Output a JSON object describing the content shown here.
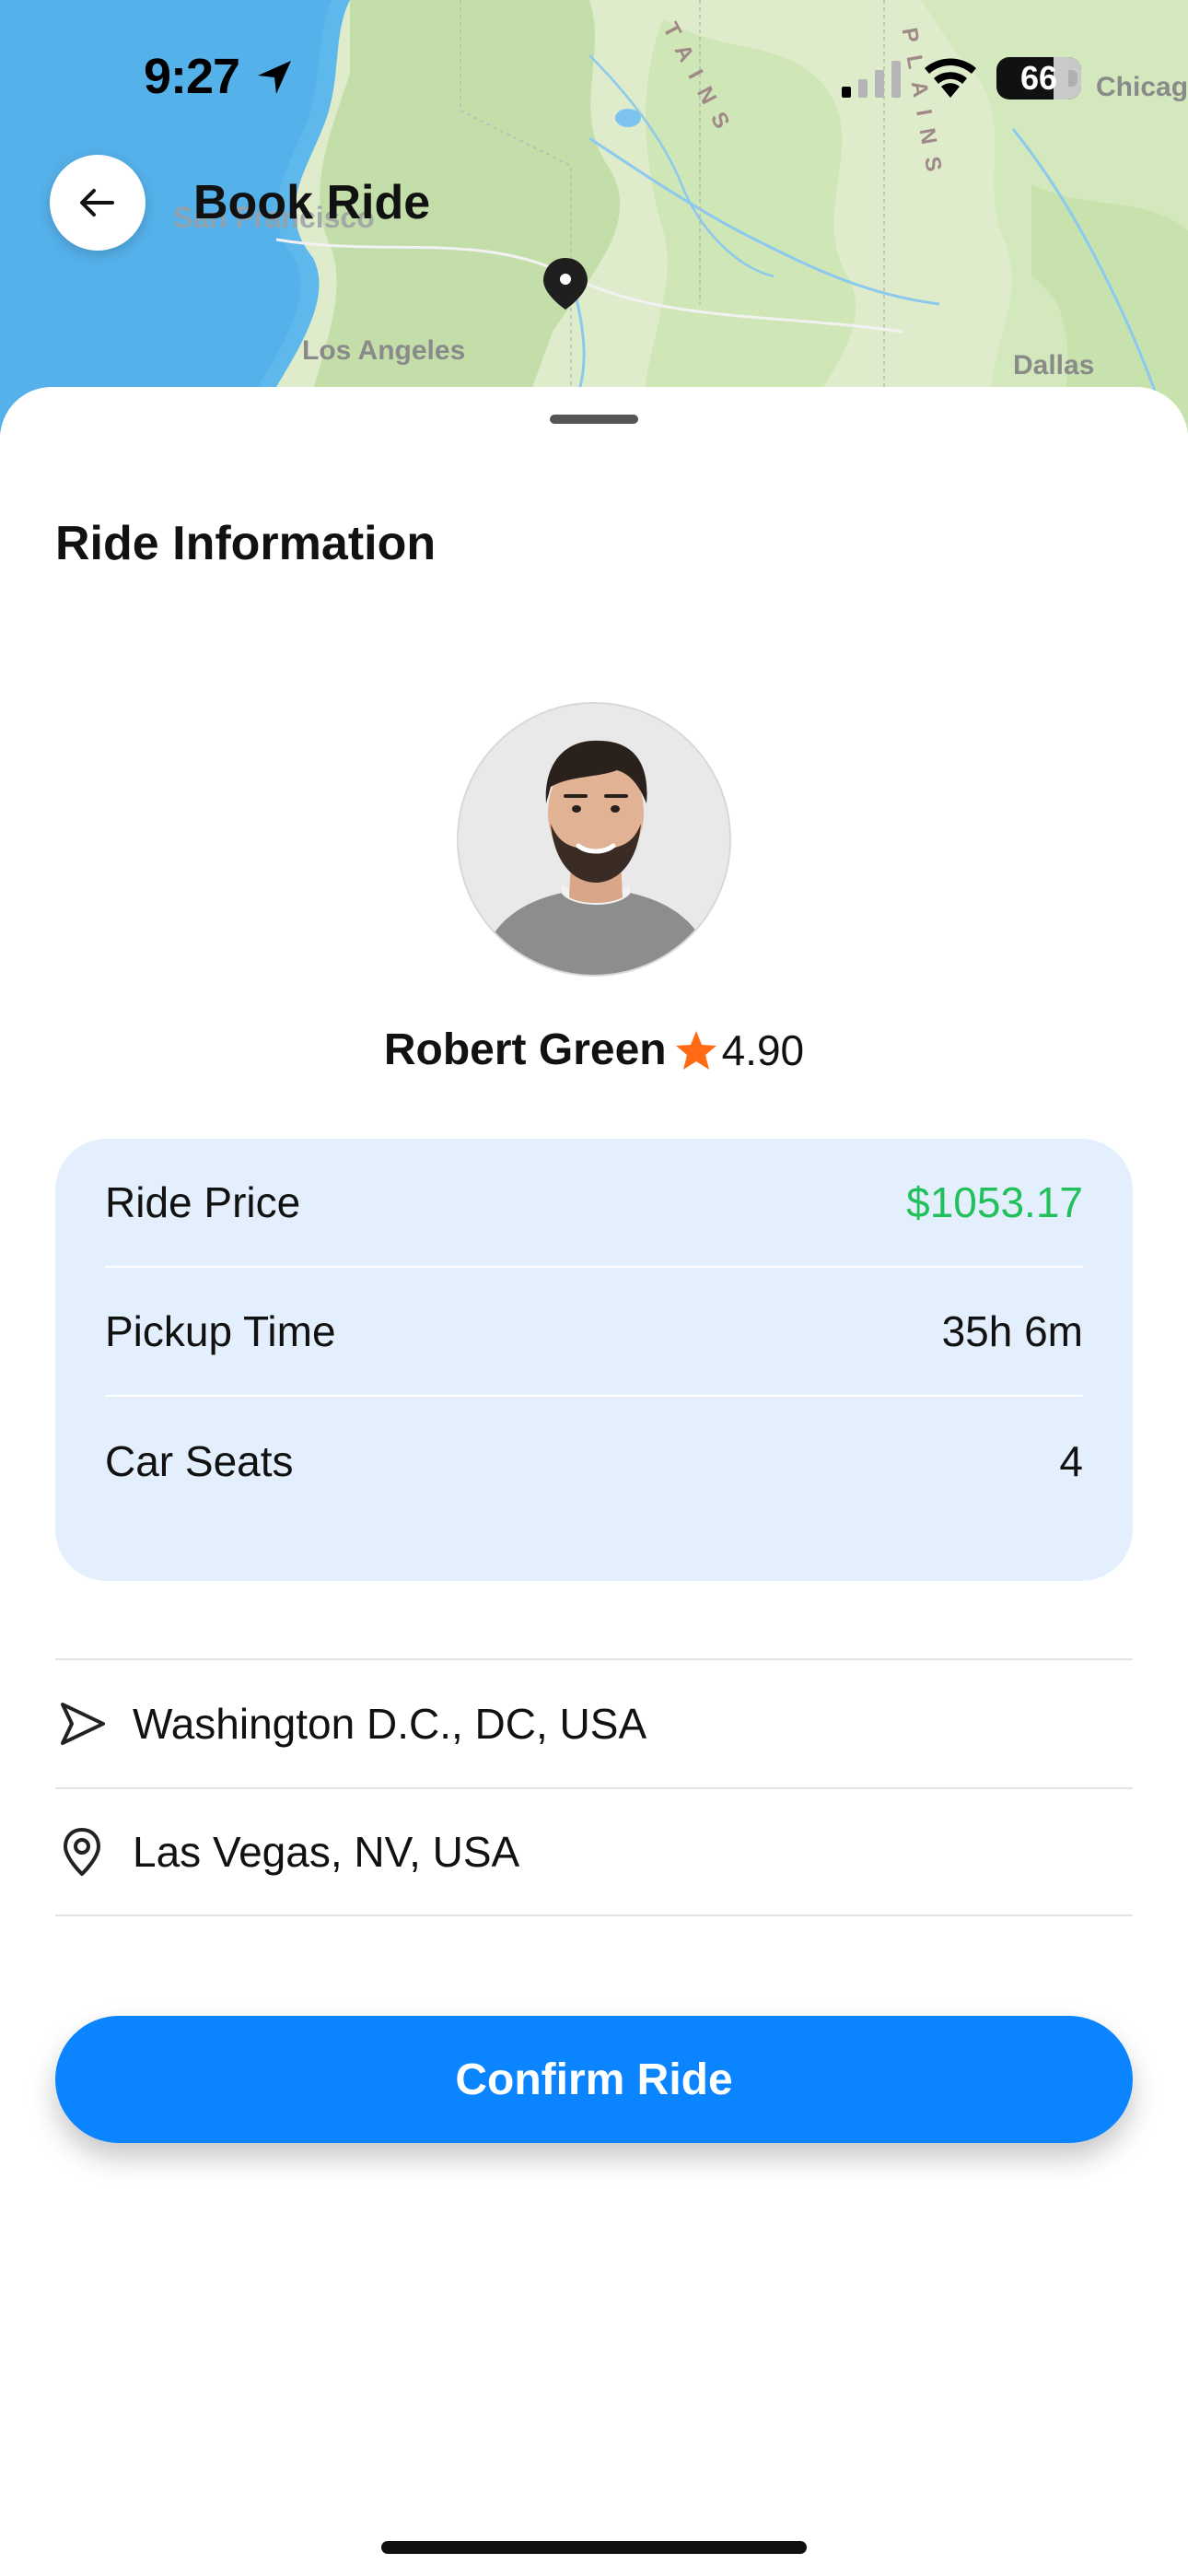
{
  "status_bar": {
    "time": "9:27",
    "battery": "66",
    "icons": [
      "location-arrow-icon",
      "cellular-signal-icon",
      "wifi-icon",
      "battery-icon"
    ]
  },
  "map": {
    "labels": {
      "san_francisco": "San Francisco",
      "los_angeles": "Los Angeles",
      "dallas": "Dallas",
      "chicago": "Chicag",
      "mountains": "TAINS",
      "plains": "PLAINS"
    }
  },
  "header": {
    "title": "Book Ride",
    "back_icon": "arrow-left-icon"
  },
  "section": {
    "title": "Ride Information"
  },
  "driver": {
    "name": "Robert Green",
    "rating": "4.90",
    "star_color": "#ff6a13"
  },
  "ride_info": {
    "price_label": "Ride Price",
    "price_value": "$1053.17",
    "price_color": "#22c05b",
    "pickup_label": "Pickup Time",
    "pickup_value": "35h 6m",
    "seats_label": "Car Seats",
    "seats_value": "4"
  },
  "route": {
    "from": "Washington D.C., DC, USA",
    "to": "Las Vegas, NV, USA"
  },
  "actions": {
    "confirm_label": "Confirm Ride",
    "accent": "#0a84ff"
  }
}
